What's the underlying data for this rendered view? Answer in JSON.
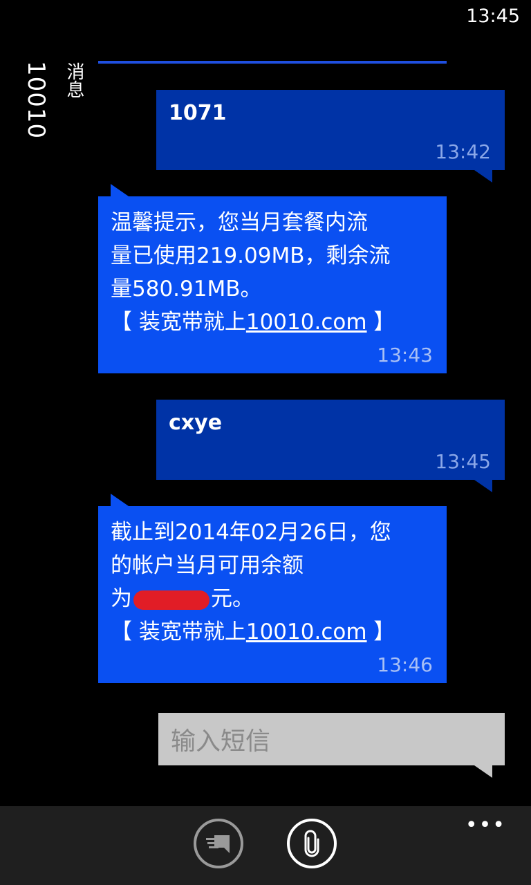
{
  "status": {
    "time": "13:45"
  },
  "header": {
    "contact": "10010",
    "app_label": "消息"
  },
  "messages": [
    {
      "type": "sent",
      "text": "1071",
      "time": "13:42"
    },
    {
      "type": "received",
      "line1": "温馨提示，您当月套餐内流",
      "line2": "量已使用219.09MB，剩余流",
      "line3": "量580.91MB。",
      "promo_prefix": "【 装宽带就上",
      "promo_link": "10010.com",
      "promo_suffix": " 】",
      "time": "13:43"
    },
    {
      "type": "sent",
      "text": "cxye",
      "time": "13:45"
    },
    {
      "type": "received",
      "line1": "截止到2014年02月26日，您",
      "line2": "的帐户当月可用余额",
      "line3_prefix": "为",
      "line3_suffix": "元。",
      "promo_prefix": "【 装宽带就上",
      "promo_link": "10010.com",
      "promo_suffix": " 】",
      "time": "13:46"
    }
  ],
  "compose": {
    "placeholder": "输入短信"
  },
  "appbar": {
    "more": "•••",
    "icons": [
      "conversation-icon",
      "attachment-icon"
    ]
  },
  "colors": {
    "sent_bubble": "#0033a6",
    "received_bubble": "#0a50f2",
    "compose": "#c8c8c8",
    "appbar": "#1f1f1f"
  }
}
